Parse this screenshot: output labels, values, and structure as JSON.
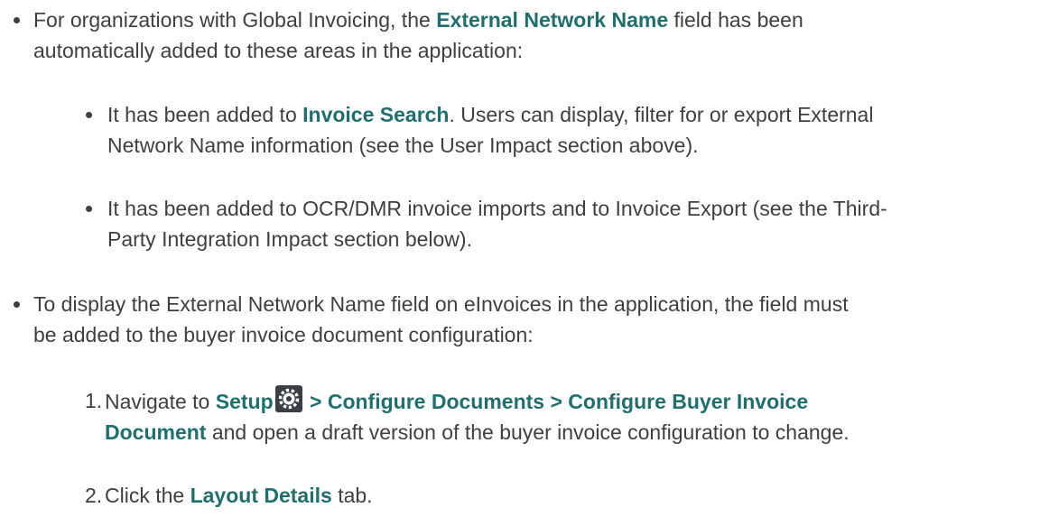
{
  "bullets": [
    {
      "pre": "For organizations with Global Invoicing, the ",
      "strong": "External Network Name",
      "post": " field has been",
      "line2": "automatically added to these areas in the application:"
    },
    {
      "pre": "It has been added to ",
      "strong": "Invoice Search",
      "post": ". Users can display, filter for or export External",
      "line2": "Network Name information (see the User Impact section above)."
    },
    {
      "line1": "It has been added to OCR/DMR invoice imports and to Invoice Export (see the Third-",
      "line2": "Party Integration Impact section below)."
    },
    {
      "line1": "To display the External Network Name field on eInvoices in the application, the field must",
      "line2": "be added to the buyer invoice document configuration:"
    }
  ],
  "steps": [
    {
      "num": "1.",
      "pre": "Navigate to ",
      "strong1": "Setup",
      "icon": "gear-icon",
      "strong2": " > Configure Documents > Configure Buyer Invoice",
      "strong3": "Document",
      "post": " and open a draft version of the buyer invoice configuration to change."
    },
    {
      "num": "2.",
      "pre": "Click the ",
      "strong": "Layout Details",
      "post": " tab."
    }
  ],
  "colors": {
    "text": "#3f3f3f",
    "emphasis": "#1f6f6f"
  }
}
